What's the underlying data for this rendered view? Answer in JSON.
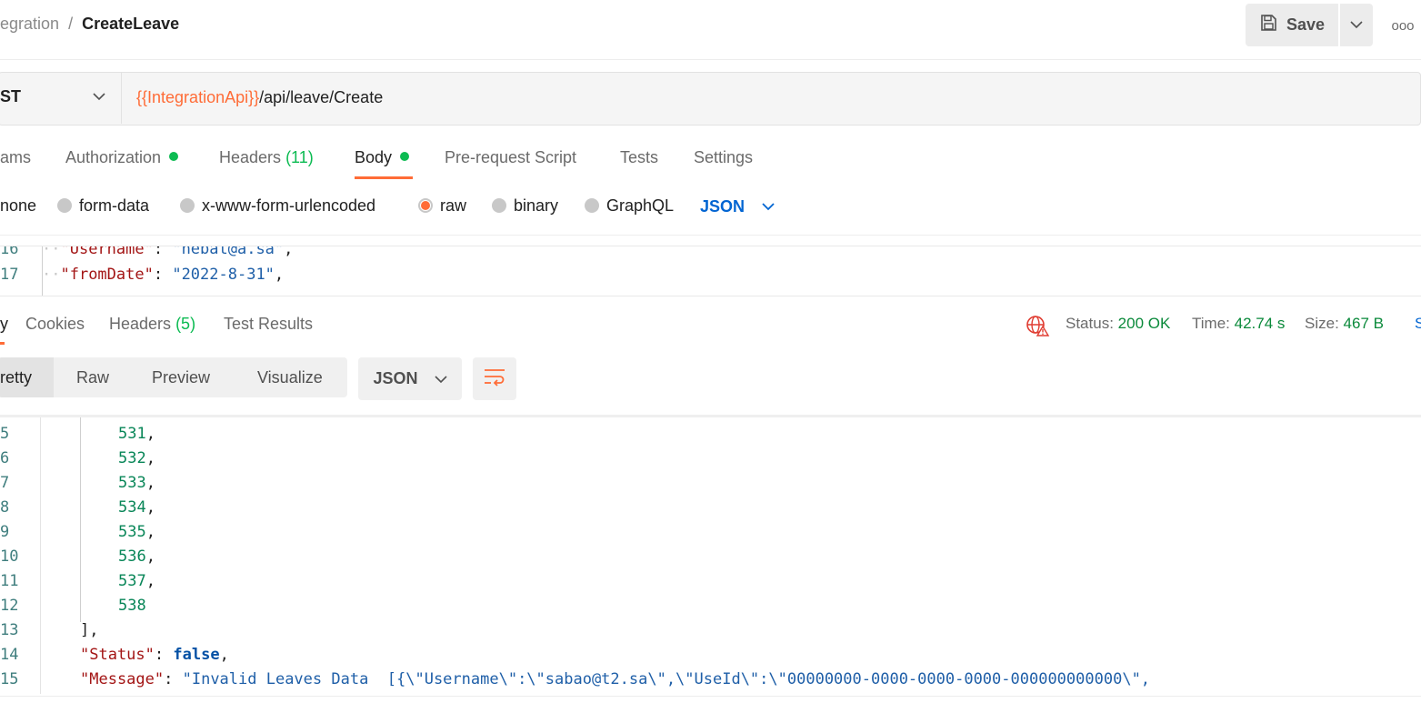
{
  "header": {
    "breadcrumb_parent": "egration",
    "breadcrumb_separator": "/",
    "breadcrumb_current": "CreateLeave",
    "save_label": "Save",
    "more_label": "ooo"
  },
  "request": {
    "method": "ST",
    "url_variable": "{{IntegrationApi}}",
    "url_path": "/api/leave/Create"
  },
  "request_tabs": [
    {
      "label": "ams"
    },
    {
      "label": "Authorization"
    },
    {
      "label": "Headers",
      "count": "(11)"
    },
    {
      "label": "Body"
    },
    {
      "label": "Pre-request Script"
    },
    {
      "label": "Tests"
    },
    {
      "label": "Settings"
    }
  ],
  "body_types": {
    "items": [
      "none",
      "form-data",
      "x-www-form-urlencoded",
      "raw",
      "binary",
      "GraphQL"
    ],
    "selected": "raw",
    "format": "JSON"
  },
  "request_code": [
    {
      "line": "16",
      "key": "\"Username\"",
      "value": "\"hebat@a.sa\""
    },
    {
      "line": "17",
      "key": "\"fromDate\"",
      "value": "\"2022-8-31\""
    }
  ],
  "response": {
    "tabs": [
      {
        "label": "y"
      },
      {
        "label": "Cookies"
      },
      {
        "label": "Headers",
        "count": "(5)"
      },
      {
        "label": "Test Results"
      }
    ],
    "status_label": "Status:",
    "status_value": "200 OK",
    "time_label": "Time:",
    "time_value": "42.74 s",
    "size_label": "Size:",
    "size_value": "467 B",
    "truncated": "S",
    "view_tabs": [
      "retty",
      "Raw",
      "Preview",
      "Visualize"
    ],
    "format": "JSON"
  },
  "response_code": {
    "numbers": [
      {
        "ln": "5",
        "val": "531"
      },
      {
        "ln": "6",
        "val": "532"
      },
      {
        "ln": "7",
        "val": "533"
      },
      {
        "ln": "8",
        "val": "534"
      },
      {
        "ln": "9",
        "val": "535"
      },
      {
        "ln": "10",
        "val": "536"
      },
      {
        "ln": "11",
        "val": "537"
      },
      {
        "ln": "12",
        "val": "538"
      }
    ],
    "close_ln": "13",
    "close_text": "],",
    "status_ln": "14",
    "status_key": "\"Status\"",
    "status_val": "false",
    "message_ln": "15",
    "message_key": "\"Message\"",
    "message_val": "\"Invalid Leaves Data  [{\\\"Username\\\":\\\"sabao@t2.sa\\\",\\\"UseId\\\":\\\"00000000-0000-0000-0000-000000000000\\\","
  },
  "colors": {
    "accent": "#ff6c37",
    "success": "#0cbb52",
    "link": "#0265d2"
  }
}
